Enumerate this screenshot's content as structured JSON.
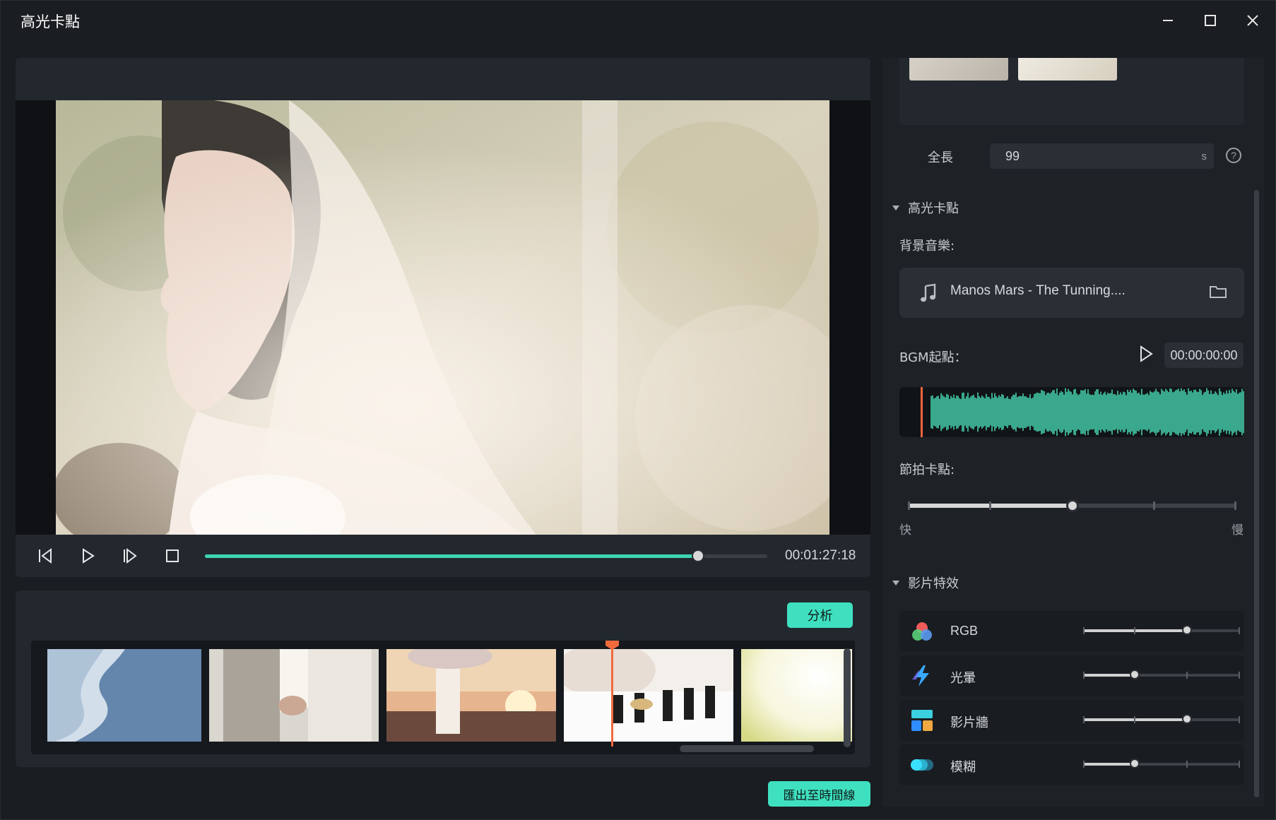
{
  "window": {
    "title": "高光卡點"
  },
  "player": {
    "timecode": "00:01:27:18",
    "progress": 0.877
  },
  "clips": {
    "analyze_label": "分析",
    "items": [
      "ocean-waves",
      "holding-hands",
      "sunset-arch",
      "piano-rings",
      "bright-light"
    ],
    "playhead_clip_index": 3
  },
  "export_label": "匯出至時間線",
  "settings": {
    "length_label": "全長",
    "length_value": "99",
    "length_unit": "s",
    "highlight_section": "高光卡點",
    "bgm_label": "背景音樂:",
    "music_name": "Manos Mars - The Tunning....",
    "bgm_start_label": "BGM起點：",
    "bgm_start_time": "00:00:00:00",
    "beat_label": "節拍卡點:",
    "beat_fast": "快",
    "beat_slow": "慢",
    "beat_level": 0.5,
    "effects_section": "影片特效",
    "effects": [
      {
        "label": "RGB",
        "icon": "rgb-icon",
        "level": 0.66
      },
      {
        "label": "光暈",
        "icon": "glow-icon",
        "level": 0.33
      },
      {
        "label": "影片牆",
        "icon": "video-wall-icon",
        "level": 0.66
      },
      {
        "label": "模糊",
        "icon": "blur-icon",
        "level": 0.33
      }
    ]
  },
  "colors": {
    "accent": "#3fe0c0",
    "playhead": "#f06a3c",
    "waveform": "#3aa88c"
  }
}
